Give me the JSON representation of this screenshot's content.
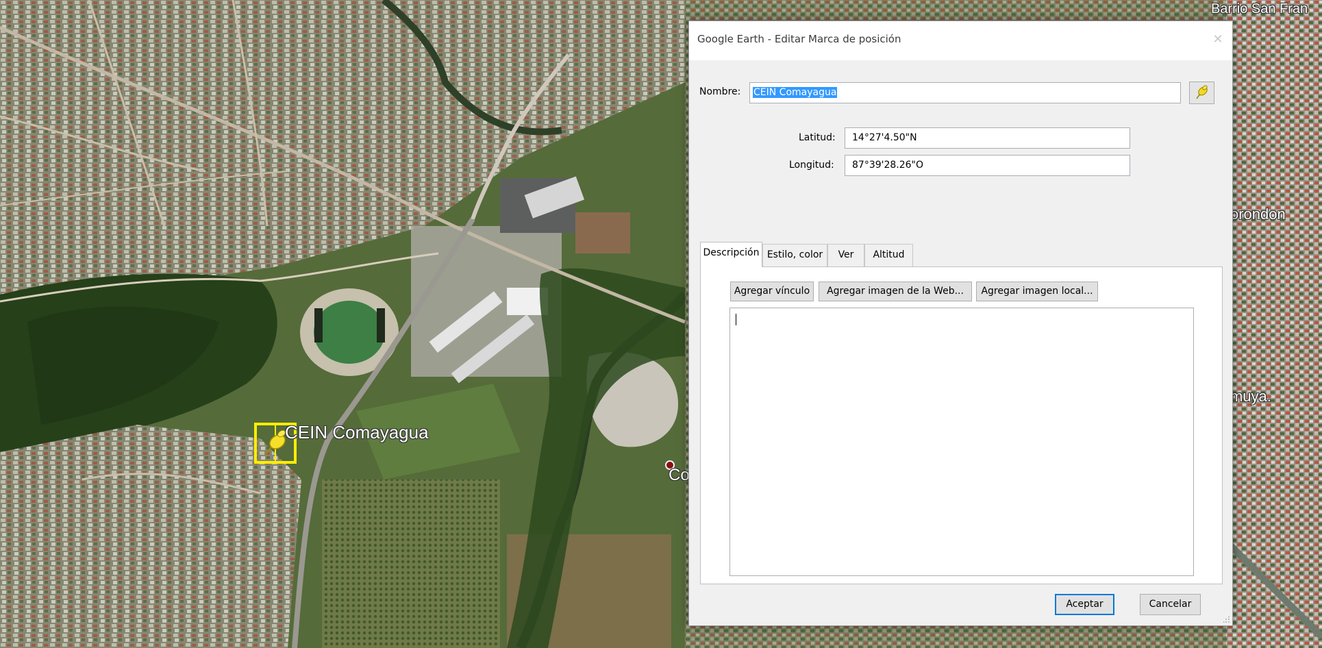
{
  "map": {
    "place_labels": {
      "barrio": "Barrio San Fran",
      "torondon": "orondon",
      "muya": "muya.",
      "co": "Co"
    },
    "placemark_label": "CEIN Comayagua",
    "pin_color": "#ffee00"
  },
  "dialog": {
    "title": "Google Earth - Editar Marca de posición",
    "close_icon": "close-icon",
    "name_label": "Nombre:",
    "name_value": "CEIN Comayagua",
    "pin_icon": "pushpin-icon",
    "lat_label": "Latitud:",
    "lat_value": "14°27'4.50\"N",
    "lon_label": "Longitud:",
    "lon_value": "87°39'28.26\"O",
    "tabs": [
      "Descripción",
      "Estilo, color",
      "Ver",
      "Altitud"
    ],
    "active_tab": "Descripción",
    "panel_buttons": [
      "Agregar vínculo",
      "Agregar imagen de la Web...",
      "Agregar imagen local..."
    ],
    "description_value": "",
    "ok_label": "Aceptar",
    "cancel_label": "Cancelar"
  },
  "colors": {
    "selection": "#3399ff",
    "default_button_border": "#0078d7"
  }
}
